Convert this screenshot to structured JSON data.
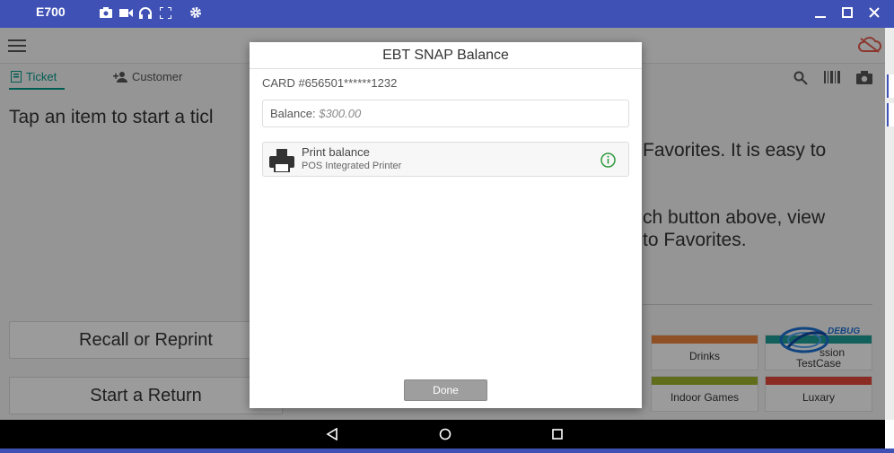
{
  "emulator": {
    "title": "E700",
    "tools": [
      "camera-icon",
      "video-icon",
      "headset-icon",
      "fullscreen-icon",
      "settings-icon"
    ],
    "window_controls": [
      "minimize-icon",
      "maximize-icon",
      "close-icon"
    ]
  },
  "app": {
    "tabs": [
      {
        "label": "Ticket",
        "active": true
      },
      {
        "label": "Customer",
        "active": false
      }
    ],
    "empty_ticket_hint": "Tap an item to start a ticl",
    "favorites_hint_lines": [
      "Favorites. It is easy to",
      "",
      "ch button above, view",
      "to Favorites."
    ],
    "recall_button": "Recall or Reprint",
    "return_button": "Start a Return",
    "favorites": [
      {
        "label": "Drinks",
        "color": "#e8823d"
      },
      {
        "label": "Indoor Games",
        "color": "#9cb12a"
      },
      {
        "label": "Luxary",
        "color": "#e0483a"
      },
      {
        "label": "ssion",
        "label2": "TestCase",
        "color": "#1d9b94"
      }
    ],
    "debug_badge": "DEBUG"
  },
  "dialog": {
    "title": "EBT SNAP Balance",
    "card_number": "CARD #656501******1232",
    "balance_label": "Balance:",
    "balance_value": "$300.00",
    "print_title": "Print balance",
    "print_subtitle": "POS Integrated Printer",
    "done_label": "Done"
  },
  "colors": {
    "accent": "#3f51b5",
    "teal": "#009688",
    "info_green": "#2e9a3a"
  }
}
